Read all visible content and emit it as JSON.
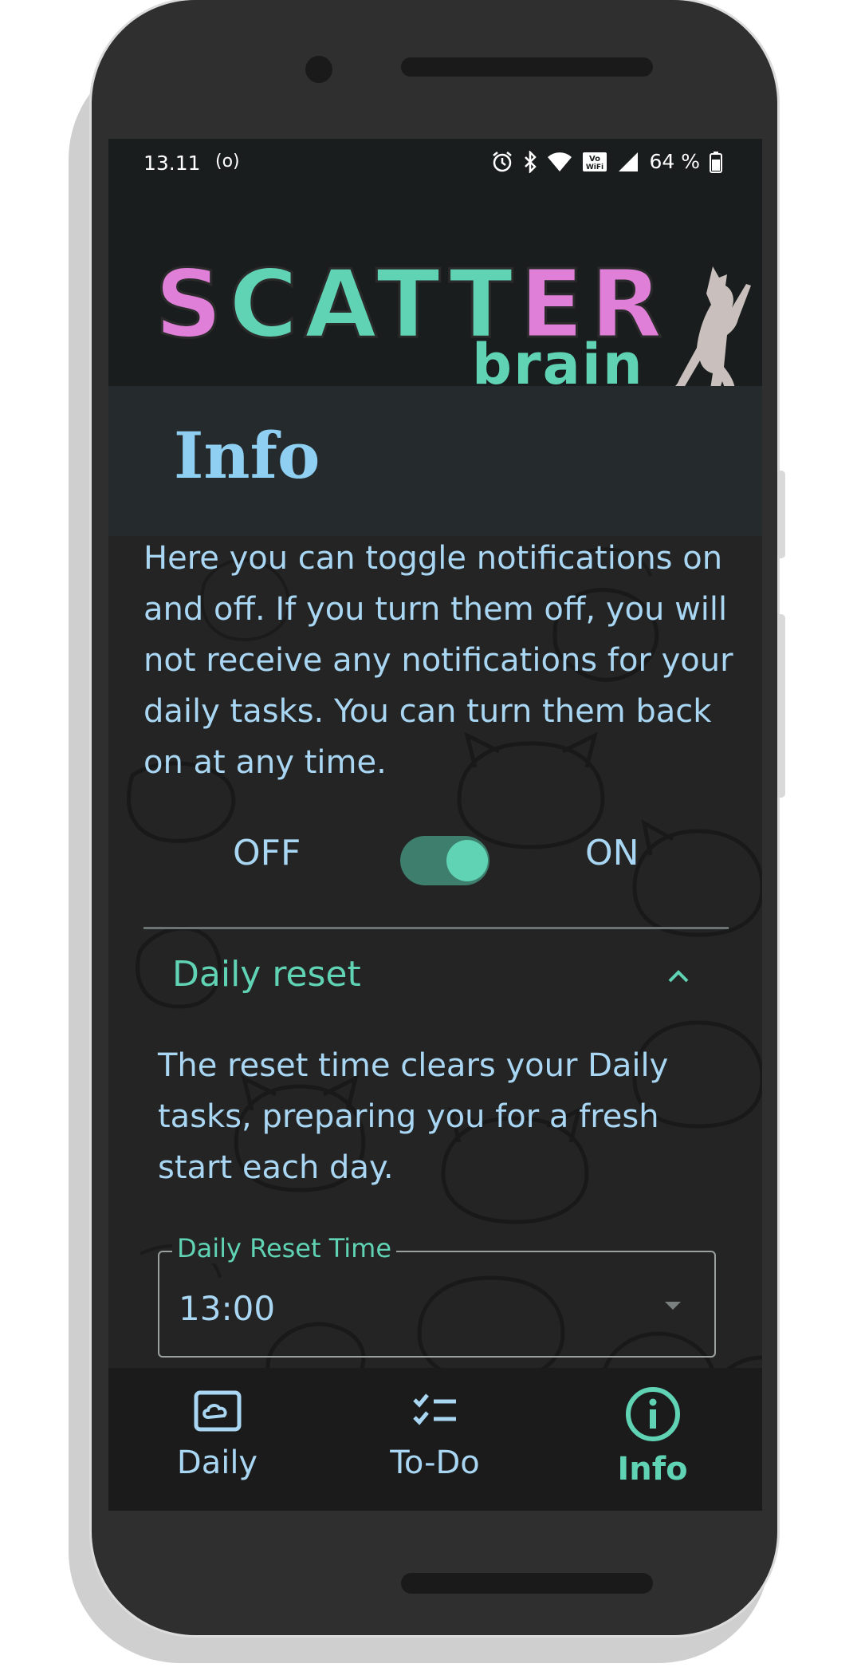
{
  "status_bar": {
    "time": "13.11",
    "radio_indicator": "(o)",
    "battery": "64 %",
    "icons": [
      "alarm-icon",
      "bluetooth-icon",
      "wifi-icon",
      "vowifi-icon",
      "signal-icon",
      "battery-icon"
    ]
  },
  "header": {
    "logo_title": "SCATTER",
    "logo_subtitle": "brain",
    "logo_letters": [
      {
        "char": "S",
        "color": "#df7fd8"
      },
      {
        "char": "C",
        "color": "#5fd3b4"
      },
      {
        "char": "A",
        "color": "#5fd3b4"
      },
      {
        "char": "T",
        "color": "#5fd3b4"
      },
      {
        "char": "T",
        "color": "#5fd3b4"
      },
      {
        "char": "E",
        "color": "#df7fd8"
      },
      {
        "char": "R",
        "color": "#df7fd8"
      }
    ]
  },
  "page": {
    "title": "Info",
    "intro_text": "Here you can toggle notifications on and off. If you turn them off, you will not receive any notifications for your daily tasks. You can turn them back on at any time."
  },
  "notifications_toggle": {
    "off_label": "OFF",
    "on_label": "ON",
    "state": "on"
  },
  "daily_reset": {
    "title": "Daily reset",
    "expanded": true,
    "description": "The reset time clears your Daily tasks, preparing you for a fresh start each day.",
    "select_label": "Daily Reset Time",
    "select_value": "13:00"
  },
  "bottom_nav": {
    "items": [
      {
        "label": "Daily",
        "icon": "cloud-frame-icon",
        "active": false
      },
      {
        "label": "To-Do",
        "icon": "checklist-icon",
        "active": false
      },
      {
        "label": "Info",
        "icon": "info-circle-icon",
        "active": true
      }
    ]
  },
  "colors": {
    "accent": "#5fd3b4",
    "text": "#a8d6f3",
    "pink": "#df7fd8",
    "background": "#242424"
  }
}
